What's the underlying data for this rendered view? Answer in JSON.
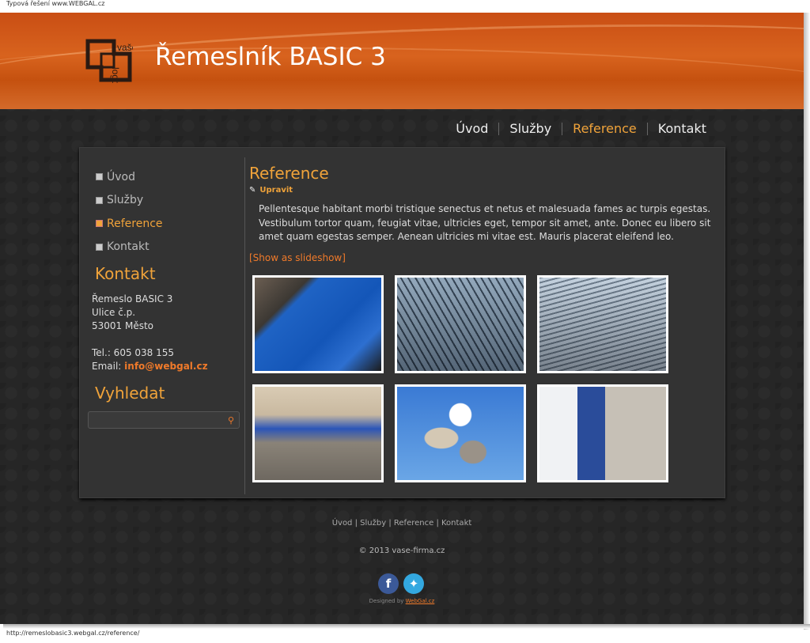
{
  "browser": {
    "tab_title": "Typová řešení www.WEBGAL.cz",
    "status_url": "http://remeslobasic3.webgal.cz/reference/"
  },
  "header": {
    "logo_text_top": "vaše",
    "logo_text_bottom": "logo",
    "site_title": "Řemeslník BASIC 3"
  },
  "topnav": {
    "items": [
      {
        "label": "Úvod",
        "active": false
      },
      {
        "label": "Služby",
        "active": false
      },
      {
        "label": "Reference",
        "active": true
      },
      {
        "label": "Kontakt",
        "active": false
      }
    ]
  },
  "sidebar": {
    "items": [
      {
        "label": "Úvod",
        "active": false
      },
      {
        "label": "Služby",
        "active": false
      },
      {
        "label": "Reference",
        "active": true
      },
      {
        "label": "Kontakt",
        "active": false
      }
    ],
    "contact_heading": "Kontakt",
    "address": {
      "line1": "Řemeslo BASIC 3",
      "line2": "Ulice č.p.",
      "line3": "53001 Město",
      "phone": "Tel.: 605 038 155",
      "email_label": "Email:",
      "email": "info@webgal.cz"
    },
    "search_heading": "Vyhledat",
    "search_placeholder": ""
  },
  "main": {
    "title": "Reference",
    "edit_label": "Upravit",
    "description": "Pellentesque habitant morbi tristique senectus et netus et malesuada fames ac turpis egestas. Vestibulum tortor quam, feugiat vitae, ultricies eget, tempor sit amet, ante. Donec eu libero sit amet quam egestas semper. Aenean ultricies mi vitae est. Mauris placerat eleifend leo.",
    "slideshow_link": "[Show as slideshow]",
    "gallery": [
      {
        "subject": "blue-steel-joint"
      },
      {
        "subject": "steel-roof-truss"
      },
      {
        "subject": "steel-roof-structure"
      },
      {
        "subject": "scaffold-walkway"
      },
      {
        "subject": "water-towers"
      },
      {
        "subject": "crane-and-silo"
      }
    ]
  },
  "footer": {
    "nav": [
      {
        "label": "Úvod"
      },
      {
        "label": "Služby"
      },
      {
        "label": "Reference"
      },
      {
        "label": "Kontakt"
      }
    ],
    "separator": "|",
    "copyright": "© 2013 vase-firma.cz",
    "designed_by_prefix": "Designed by",
    "designed_by_link": "WebGal.cz",
    "social": [
      "facebook-icon",
      "twitter-icon"
    ]
  },
  "colors": {
    "accent": "#f0a33a",
    "link": "#f07a2a",
    "header": "#c94e14",
    "background": "#262626",
    "panel": "#333333"
  }
}
